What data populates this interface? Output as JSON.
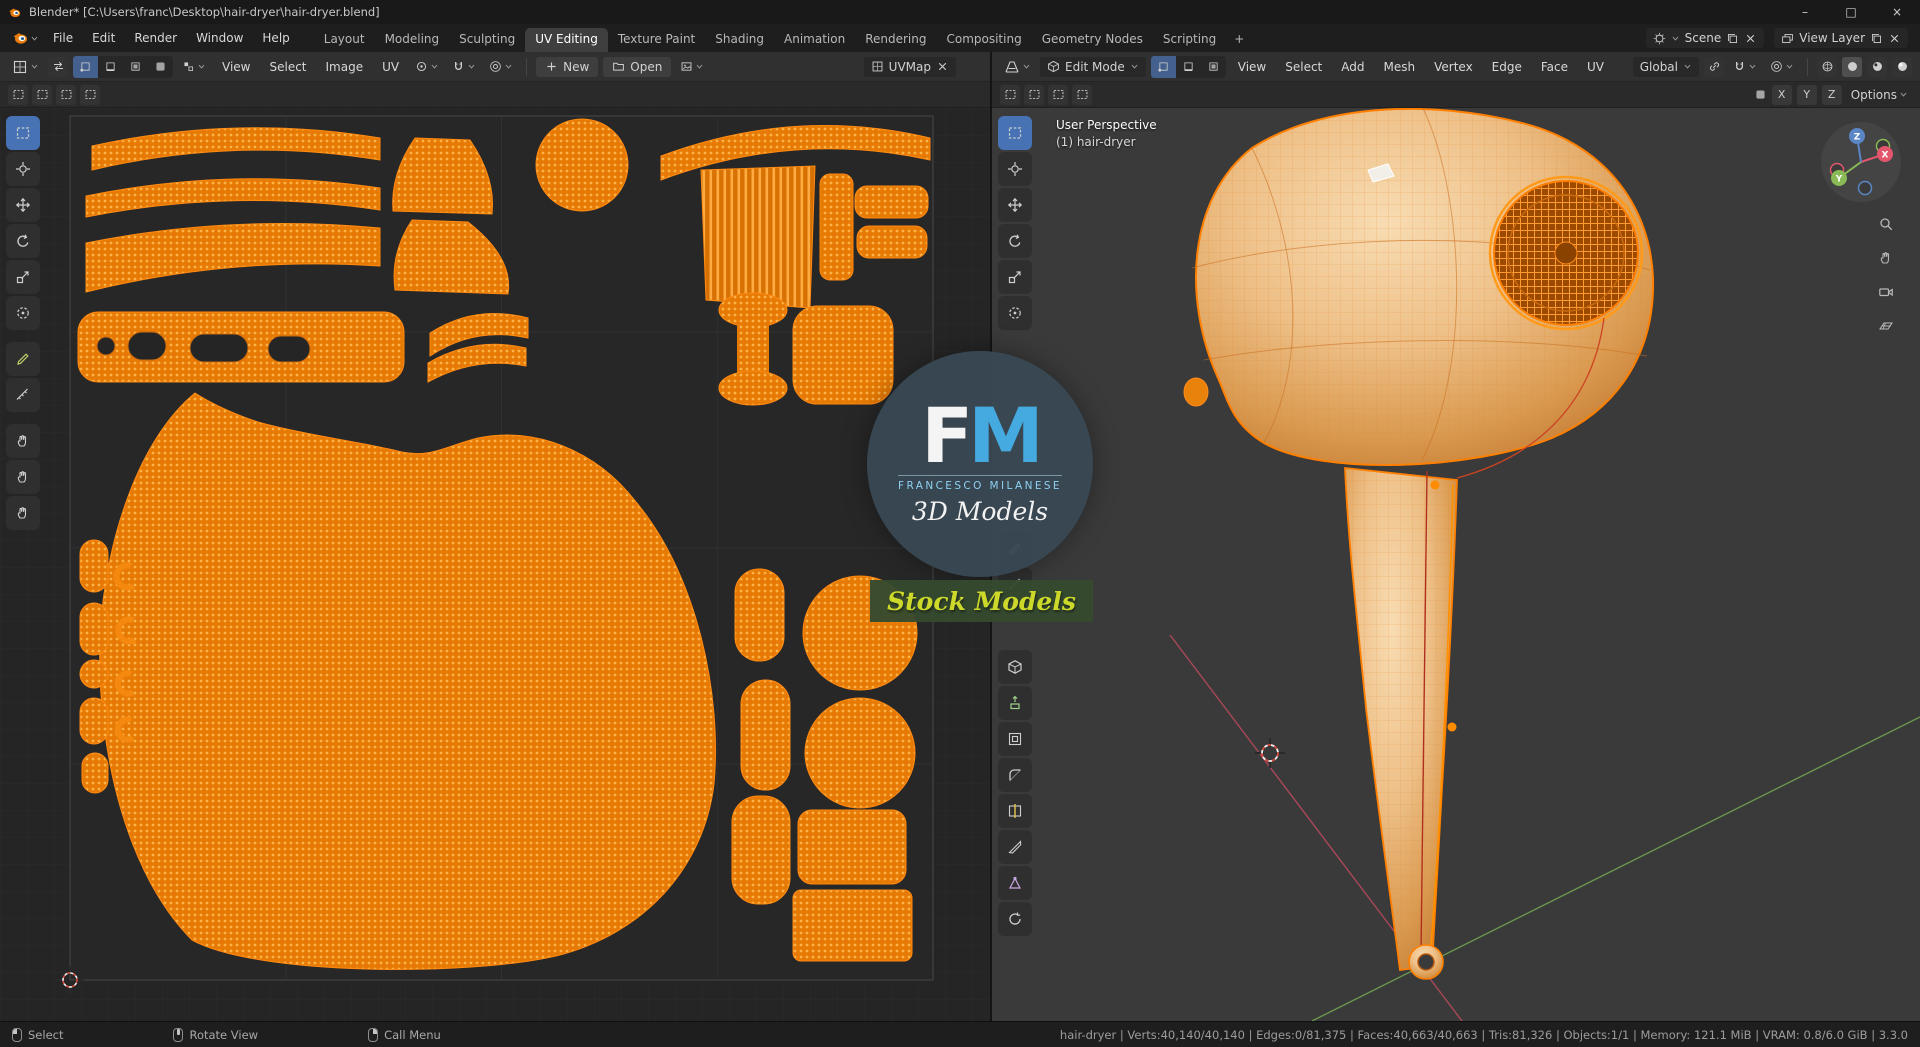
{
  "colors": {
    "accent": "#4772b3",
    "selection_orange": "#ff8d1a",
    "axis_x": "#bd4a5e",
    "axis_y": "#6fa252"
  },
  "titlebar": {
    "title": "Blender* [C:\\Users\\franc\\Desktop\\hair-dryer\\hair-dryer.blend]",
    "minimize": "–",
    "maximize": "□",
    "close": "×"
  },
  "menubar": {
    "menus": [
      "File",
      "Edit",
      "Render",
      "Window",
      "Help"
    ],
    "workspaces": [
      "Layout",
      "Modeling",
      "Sculpting",
      "UV Editing",
      "Texture Paint",
      "Shading",
      "Animation",
      "Rendering",
      "Compositing",
      "Geometry Nodes",
      "Scripting"
    ],
    "add_workspace": "+",
    "scene_label": "Scene",
    "view_layer_label": "View Layer"
  },
  "uv_editor": {
    "menus": [
      "View",
      "Select",
      "Image",
      "UV"
    ],
    "new_label": "New",
    "open_label": "Open",
    "uvmap_label": "UVMap"
  },
  "viewport": {
    "mode_label": "Edit Mode",
    "menus": [
      "View",
      "Select",
      "Add",
      "Mesh",
      "Vertex",
      "Edge",
      "Face",
      "UV"
    ],
    "orientation_label": "Global",
    "mirror_axes": [
      "X",
      "Y",
      "Z"
    ],
    "options_label": "Options",
    "overlay_line1": "User Perspective",
    "overlay_line2": "(1) hair-dryer",
    "gizmo": {
      "x": "X",
      "y": "Y",
      "z": "Z"
    }
  },
  "watermark": {
    "letter_f": "F",
    "letter_m": "M",
    "name": "FRANCESCO MILANESE",
    "tagline": "3D Models",
    "banner": "Stock Models"
  },
  "statusbar": {
    "hints": [
      "Select",
      "Rotate View",
      "Call Menu"
    ],
    "stats": "hair-dryer | Verts:40,140/40,140 | Edges:0/81,375 | Faces:40,663/40,663 | Tris:81,326 | Objects:1/1 | Memory: 121.1 MiB | VRAM: 0.8/6.0 GiB | 3.3.0"
  }
}
